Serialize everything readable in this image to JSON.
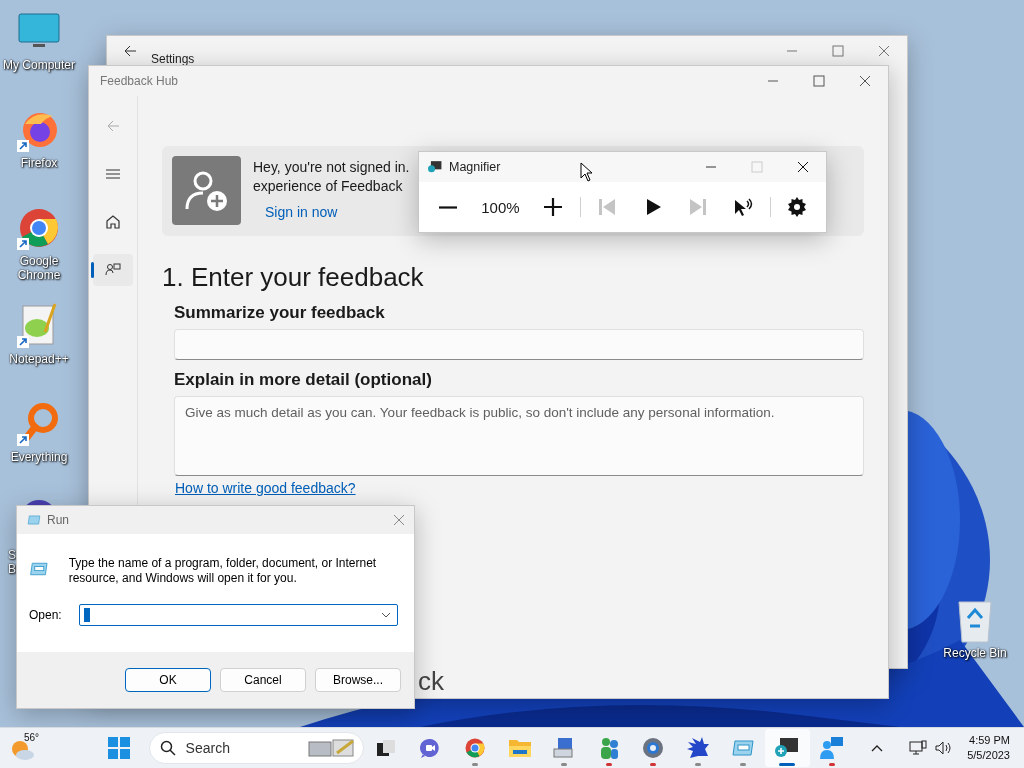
{
  "desktop_icons": [
    {
      "label": "My Computer",
      "kind": "monitor",
      "shortcut": false
    },
    {
      "label": "Firefox",
      "kind": "fox",
      "shortcut": true
    },
    {
      "label": "Google Chrome",
      "kind": "chrome",
      "shortcut": true
    },
    {
      "label": "Notepad++",
      "kind": "notepad",
      "shortcut": true
    },
    {
      "label": "Everything",
      "kind": "search",
      "shortcut": true
    },
    {
      "label": "S\nB",
      "kind": "disc"
    }
  ],
  "recycle_bin": {
    "label": "Recycle Bin"
  },
  "settings_window": {
    "title": "Settings"
  },
  "feedback_hub": {
    "title": "Feedback Hub",
    "nav": [
      {
        "kind": "menu",
        "selected": false
      },
      {
        "kind": "home",
        "selected": false
      },
      {
        "kind": "feedback",
        "selected": true
      }
    ],
    "banner": {
      "line_1": "Hey, you're not signed in.",
      "line_2": "experience of Feedback",
      "link": "Sign in now"
    },
    "form": {
      "heading": "1. Enter your feedback",
      "summary_label": "Summarize your feedback",
      "detail_label": "Explain in more detail (optional)",
      "detail_placeholder": "Give as much detail as you can. Your feedback is public, so don't include any personal information.",
      "help_link": "How to write good feedback?",
      "next_heading_fragment": "ck"
    }
  },
  "magnifier": {
    "title": "Magnifier",
    "maximize_disabled": true,
    "zoom": "100%",
    "media": [
      {
        "kind": "prev",
        "disabled": true
      },
      {
        "kind": "play",
        "disabled": false
      },
      {
        "kind": "next",
        "disabled": true
      }
    ]
  },
  "run_dialog": {
    "title": "Run",
    "message": "Type the name of a program, folder, document, or Internet resource, and Windows will open it for you.",
    "open_label": "Open:",
    "buttons": [
      {
        "label": "OK",
        "default": true
      },
      {
        "label": "Cancel",
        "default": false
      },
      {
        "label": "Browse...",
        "default": false
      }
    ]
  },
  "taskbar": {
    "weather": "56°",
    "search": {
      "placeholder": "Search"
    },
    "apps": [
      {
        "kind": "taskview",
        "running": false,
        "selected": false
      },
      {
        "kind": "chat",
        "running": false,
        "selected": false
      },
      {
        "kind": "chrome",
        "running": true,
        "attention": false,
        "selected": false
      },
      {
        "kind": "folder",
        "running": false,
        "selected": false
      },
      {
        "kind": "network",
        "running": true,
        "attention": false,
        "selected": false
      },
      {
        "kind": "userinfo",
        "running": true,
        "attention": true,
        "selected": false
      },
      {
        "kind": "gear",
        "running": true,
        "attention": true,
        "selected": false
      },
      {
        "kind": "spiky",
        "running": true,
        "attention": false,
        "selected": false
      },
      {
        "kind": "run",
        "running": true,
        "attention": false,
        "selected": false
      },
      {
        "kind": "magnifier",
        "running": true,
        "attention": false,
        "selected": true
      },
      {
        "kind": "feedback",
        "running": true,
        "attention": true,
        "selected": false
      }
    ],
    "time": "4:59 PM",
    "date": "5/5/2023"
  }
}
